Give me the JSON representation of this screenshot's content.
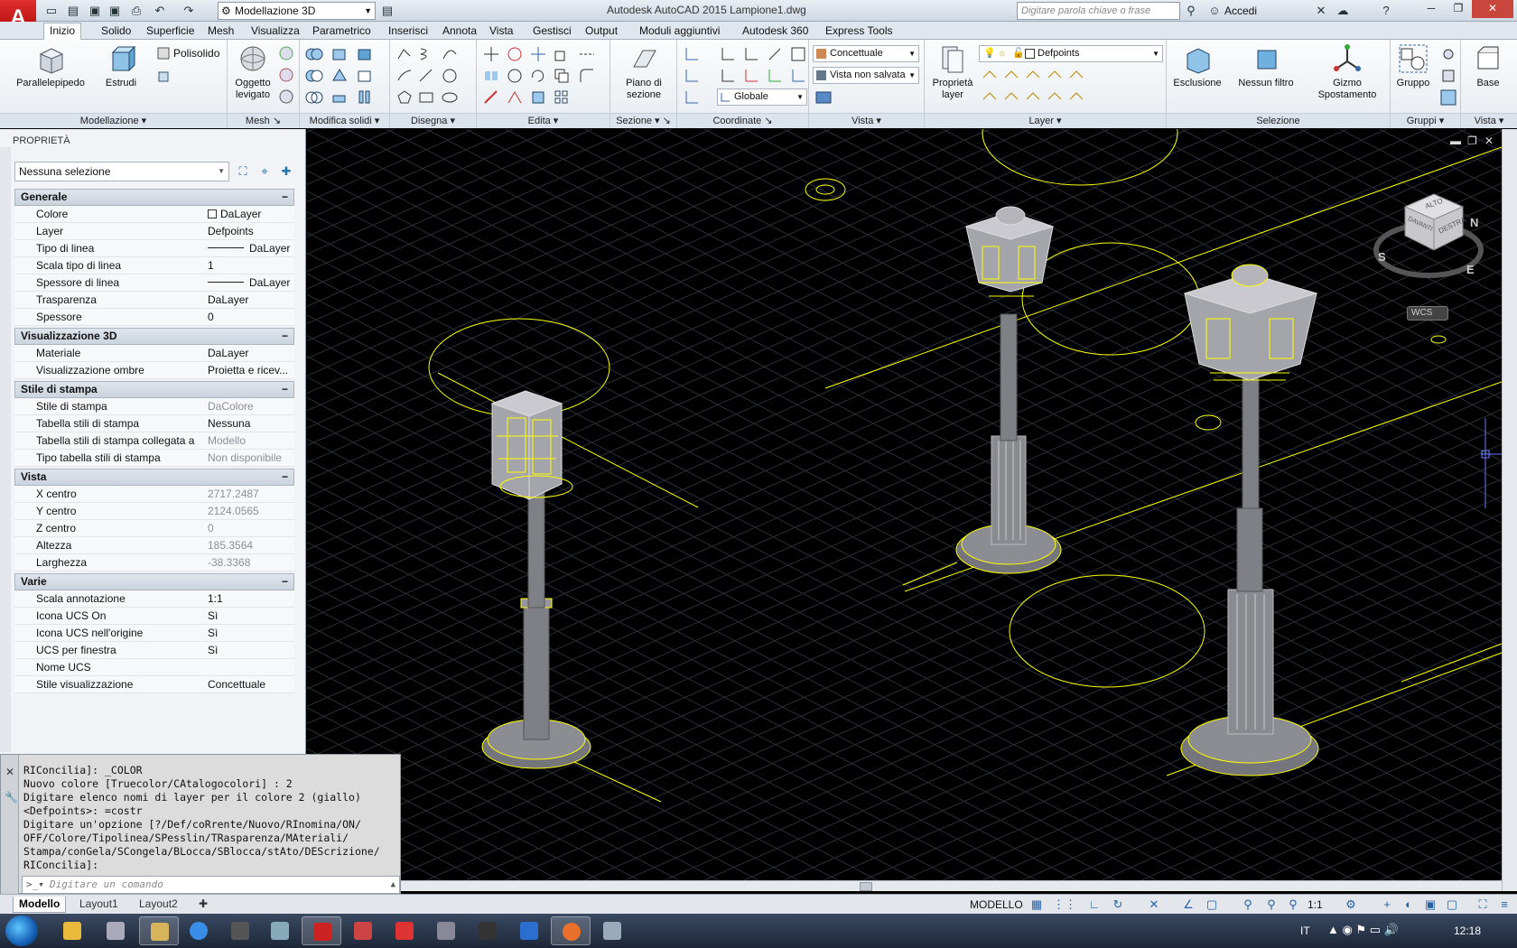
{
  "titlebar": {
    "workspace": "Modellazione 3D",
    "window_title": "Autodesk AutoCAD 2015   Lampione1.dwg",
    "search_placeholder": "Digitare parola chiave o frase",
    "signin": "Accedi"
  },
  "ribbon_tabs": [
    "Inizio",
    "Solido",
    "Superficie",
    "Mesh",
    "Visualizza",
    "Parametrico",
    "Inserisci",
    "Annota",
    "Vista",
    "Gestisci",
    "Output",
    "Moduli aggiuntivi",
    "Autodesk 360",
    "Express Tools"
  ],
  "ribbon": {
    "panels": [
      "Modellazione",
      "Mesh",
      "Modifica solidi",
      "Disegna",
      "Edita",
      "Sezione",
      "Coordinate",
      "Vista",
      "Layer",
      "Selezione",
      "Gruppi",
      "Vista"
    ],
    "buttons": {
      "parallelepipedo": "Parallelepipedo",
      "estrudi": "Estrudi",
      "polisolido": "Polisolido",
      "oggetto_levigato": "Oggetto\nlevigato",
      "piano_sezione": "Piano di\nsezione",
      "proprieta_layer": "Proprietà\nlayer",
      "esclusione": "Esclusione",
      "nessun_filtro": "Nessun filtro",
      "gizmo": "Gizmo\nSpostamento",
      "gruppo": "Gruppo",
      "base": "Base"
    },
    "combos": {
      "visual_style": "Concettuale",
      "named_view": "Vista non salvata",
      "ucs": "Globale",
      "layer": "Defpoints"
    }
  },
  "properties": {
    "title": "PROPRIETÀ",
    "selection": "Nessuna selezione",
    "categories": [
      {
        "name": "Generale",
        "rows": [
          {
            "name": "Colore",
            "value": "DaLayer",
            "kind": "swatch"
          },
          {
            "name": "Layer",
            "value": "Defpoints"
          },
          {
            "name": "Tipo di linea",
            "value": "DaLayer",
            "kind": "line"
          },
          {
            "name": "Scala tipo di linea",
            "value": "1"
          },
          {
            "name": "Spessore di linea",
            "value": "DaLayer",
            "kind": "line"
          },
          {
            "name": "Trasparenza",
            "value": "DaLayer"
          },
          {
            "name": "Spessore",
            "value": "0"
          }
        ]
      },
      {
        "name": "Visualizzazione 3D",
        "rows": [
          {
            "name": "Materiale",
            "value": "DaLayer"
          },
          {
            "name": "Visualizzazione ombre",
            "value": "Proietta e ricev..."
          }
        ]
      },
      {
        "name": "Stile di stampa",
        "rows": [
          {
            "name": "Stile di stampa",
            "value": "DaColore",
            "dim": true
          },
          {
            "name": "Tabella stili di stampa",
            "value": "Nessuna"
          },
          {
            "name": "Tabella stili di stampa collegata a",
            "value": "Modello",
            "dim": true
          },
          {
            "name": "Tipo tabella stili di stampa",
            "value": "Non disponibile",
            "dim": true
          }
        ]
      },
      {
        "name": "Vista",
        "rows": [
          {
            "name": "X centro",
            "value": "2717.2487",
            "dim": true
          },
          {
            "name": "Y centro",
            "value": "2124.0565",
            "dim": true
          },
          {
            "name": "Z centro",
            "value": "0",
            "dim": true
          },
          {
            "name": "Altezza",
            "value": "185.3564",
            "dim": true
          },
          {
            "name": "Larghezza",
            "value": "-38.3368",
            "dim": true
          }
        ]
      },
      {
        "name": "Varie",
        "rows": [
          {
            "name": "Scala annotazione",
            "value": "1:1"
          },
          {
            "name": "Icona UCS On",
            "value": "Sì"
          },
          {
            "name": "Icona UCS nell'origine",
            "value": "Sì"
          },
          {
            "name": "UCS per finestra",
            "value": "Sì"
          },
          {
            "name": "Nome UCS",
            "value": ""
          },
          {
            "name": "Stile visualizzazione",
            "value": "Concettuale"
          }
        ]
      }
    ]
  },
  "command": {
    "history": [
      "RIConcilia]: _COLOR",
      "Nuovo colore [Truecolor/CAtalogocolori] : 2",
      "Digitare elenco nomi di layer per il colore 2 (giallo)",
      "<Defpoints>: =costr",
      "Digitare un'opzione [?/Def/coRrente/Nuovo/RInomina/ON/",
      "OFF/Colore/Tipolinea/SPesslin/TRasparenza/MAteriali/",
      "Stampa/conGela/SCongela/BLocca/SBlocca/stAto/DEScrizione/",
      "RIConcilia]:"
    ],
    "placeholder": "Digitare un comando"
  },
  "viewcube": {
    "top": "ALTO",
    "front": "DAVANTI",
    "right": "DESTRA",
    "north": "N",
    "south": "S",
    "east": "E",
    "wcs": "WCS"
  },
  "layout_tabs": [
    "Modello",
    "Layout1",
    "Layout2"
  ],
  "status": {
    "model": "MODELLO",
    "scale": "1:1"
  },
  "taskbar": {
    "lang": "IT",
    "time": "12:18"
  },
  "colors": {
    "accent_yellow": "#ffff00",
    "viewport_bg": "#000000",
    "solid_gray": "#7f7f86"
  }
}
